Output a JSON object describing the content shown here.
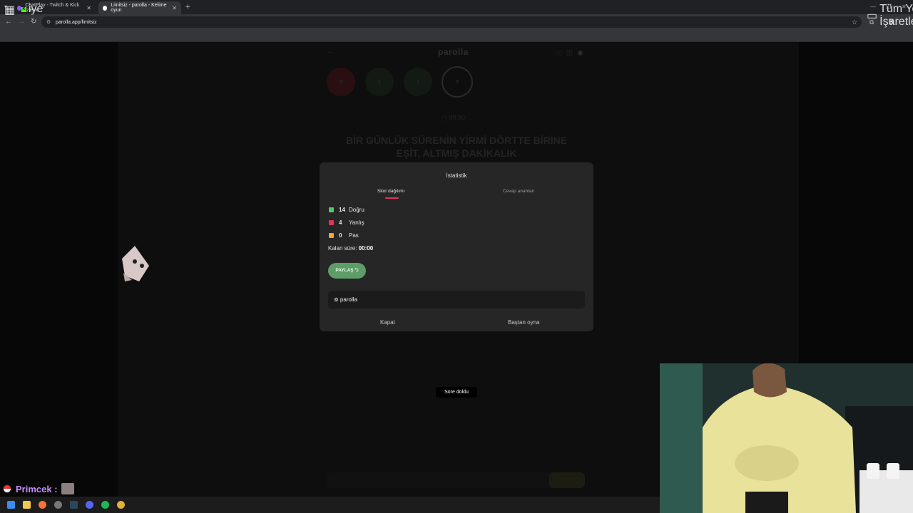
{
  "browser": {
    "tabs": [
      {
        "title": "ChatPlay - Twitch & Kick İzleyic",
        "active": false
      },
      {
        "title": "Limitsiz - parolla - Kelime oyun",
        "active": true
      }
    ],
    "url": "parolla.app/limitsiz",
    "bookmarks": {
      "kick_label": "iye",
      "all_bookmarks": "Tüm Yer İşaretleri"
    }
  },
  "page": {
    "brand": "parolla",
    "circles": [
      "0",
      "1",
      "2",
      "3"
    ],
    "timer": "00:00",
    "question": "BİR GÜNLÜK SÜRENİN YİRMİ DÖRTTE BİRİNE EŞİT, ALTMIŞ DAKİKALIK",
    "toast": "Süre doldu"
  },
  "modal": {
    "title": "İstatistik",
    "tabs": {
      "score": "Skor dağılımı",
      "answers": "Cevap anahtarı"
    },
    "stats": [
      {
        "count": "14",
        "label": "Doğru",
        "color": "#4ecb71"
      },
      {
        "count": "4",
        "label": "Yanlış",
        "color": "#e0335a"
      },
      {
        "count": "0",
        "label": "Pas",
        "color": "#f2a43a"
      }
    ],
    "remaining_label": "Kalan süre:",
    "remaining_value": "00:00",
    "share_label": "PAYLAŞ ⮌",
    "brand_line": "⊚ parolla",
    "close_label": "Kapat",
    "restart_label": "Baştan oyna"
  },
  "chat": {
    "username": "Primcek :"
  }
}
